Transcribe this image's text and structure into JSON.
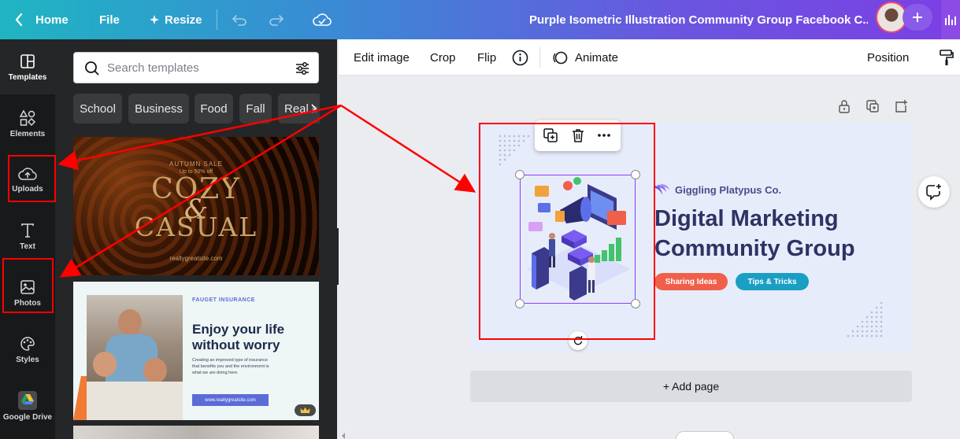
{
  "topbar": {
    "home_label": "Home",
    "file_label": "File",
    "resize_label": "Resize",
    "doc_title": "Purple Isometric Illustration Community Group Facebook C..."
  },
  "rail": [
    {
      "label": "Templates",
      "icon": "templates-icon"
    },
    {
      "label": "Elements",
      "icon": "elements-icon"
    },
    {
      "label": "Uploads",
      "icon": "uploads-icon"
    },
    {
      "label": "Text",
      "icon": "text-icon"
    },
    {
      "label": "Photos",
      "icon": "photos-icon"
    },
    {
      "label": "Styles",
      "icon": "styles-icon"
    },
    {
      "label": "Google Drive",
      "icon": "google-drive-icon"
    }
  ],
  "search": {
    "placeholder": "Search templates"
  },
  "chips": [
    "School",
    "Business",
    "Food",
    "Fall",
    "Real e"
  ],
  "templates": [
    {
      "kicker": "AUTUMN SALE",
      "sub": "Up to 50% off",
      "line1": "COZY",
      "amp": "&",
      "line2": "CASUAL",
      "site": "reallygreatsite.com"
    },
    {
      "brand": "FAUGET INSURANCE",
      "headline1": "Enjoy your life",
      "headline2": "without worry",
      "body1": "Creating an improved type of insurance",
      "body2": "that benefits you and the environment is",
      "body3": "what we are doing here.",
      "site": "www.reallygreatsite.com"
    }
  ],
  "toolbar": {
    "edit_image": "Edit image",
    "crop": "Crop",
    "flip": "Flip",
    "animate": "Animate",
    "position": "Position"
  },
  "design": {
    "brand": "Giggling Platypus Co.",
    "headline1": "Digital Marketing",
    "headline2": "Community Group",
    "pill1": "Sharing Ideas",
    "pill2": "Tips & Tricks"
  },
  "add_page_label": "+ Add page",
  "colors": {
    "accent_purple": "#8b3dff",
    "annotation_red": "#ff0000",
    "pill_orange": "#f05f4a",
    "pill_teal": "#1a9ec4",
    "headline": "#2f3264"
  }
}
